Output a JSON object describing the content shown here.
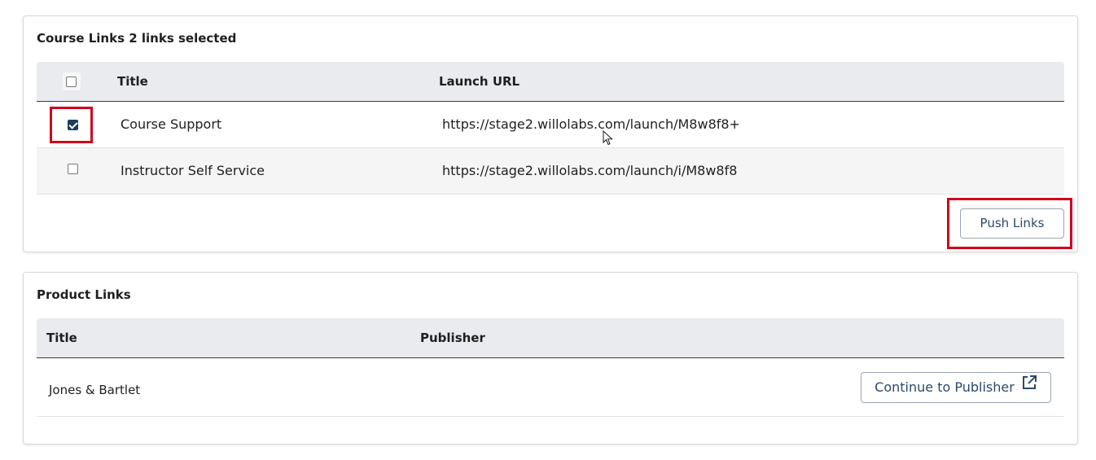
{
  "course_links": {
    "title": "Course Links 2 links selected",
    "columns": [
      "Title",
      "Launch URL"
    ],
    "rows": [
      {
        "title": "Course Support",
        "url": "https://stage2.willolabs.com/launch/M8w8f8+",
        "checked": true
      },
      {
        "title": "Instructor Self Service",
        "url": "https://stage2.willolabs.com/launch/i/M8w8f8",
        "checked": false
      }
    ],
    "push_button_label": "Push Links"
  },
  "product_links": {
    "title": "Product Links",
    "columns": [
      "Title",
      "Publisher"
    ],
    "rows": [
      {
        "title": "Jones & Bartlet",
        "action_label": "Continue to Publisher",
        "action_icon": "external-link-icon"
      }
    ]
  },
  "colors": {
    "accent": "#1e3c5e",
    "highlight": "#d0021b",
    "header_bg": "#e9ebee",
    "button_text": "#2b4a6b"
  }
}
